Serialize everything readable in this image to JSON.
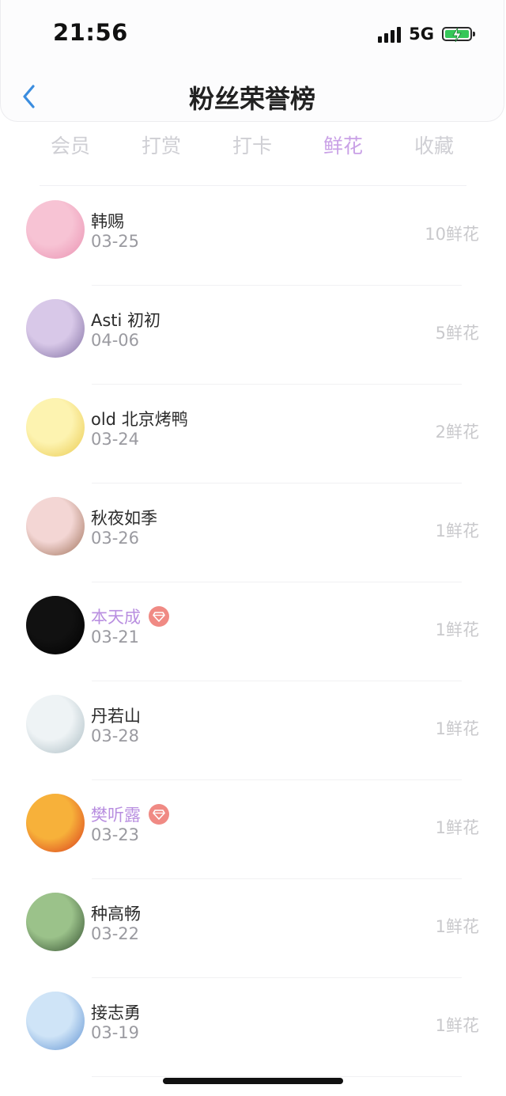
{
  "status_bar": {
    "time": "21:56",
    "network": "5G",
    "battery_level": 1.0,
    "battery_color": "#35c759"
  },
  "nav": {
    "title": "粉丝荣誉榜",
    "back_icon": "chevron-left-icon"
  },
  "tabs": [
    {
      "label": "会员",
      "active": false
    },
    {
      "label": "打赏",
      "active": false
    },
    {
      "label": "打卡",
      "active": false
    },
    {
      "label": "鲜花",
      "active": true
    },
    {
      "label": "收藏",
      "active": false
    }
  ],
  "colors": {
    "accent": "#c9a1e6",
    "vip_name": "#b98fe0",
    "vip_badge": "#f08a84",
    "back_icon": "#3b8ddf"
  },
  "fans": [
    {
      "name": "韩赐",
      "date": "03-25",
      "count": "10鲜花",
      "vip": false,
      "avatar_colors": [
        "#f7c3d4",
        "#e98fb0"
      ]
    },
    {
      "name": "Asti 初初",
      "date": "04-06",
      "count": "5鲜花",
      "vip": false,
      "avatar_colors": [
        "#d8c8e8",
        "#7c6a9e"
      ]
    },
    {
      "name": "old 北京烤鸭",
      "date": "03-24",
      "count": "2鲜花",
      "vip": false,
      "avatar_colors": [
        "#fdf3b0",
        "#e9c84a"
      ]
    },
    {
      "name": "秋夜如季",
      "date": "03-26",
      "count": "1鲜花",
      "vip": false,
      "avatar_colors": [
        "#f3d6d4",
        "#9b6b52"
      ]
    },
    {
      "name": "本天成",
      "date": "03-21",
      "count": "1鲜花",
      "vip": true,
      "avatar_colors": [
        "#111111",
        "#000000"
      ]
    },
    {
      "name": "丹若山",
      "date": "03-28",
      "count": "1鲜花",
      "vip": false,
      "avatar_colors": [
        "#eef3f5",
        "#a7b9c0"
      ]
    },
    {
      "name": "樊听露",
      "date": "03-23",
      "count": "1鲜花",
      "vip": true,
      "avatar_colors": [
        "#f7b13a",
        "#d8361b"
      ]
    },
    {
      "name": "种高畅",
      "date": "03-22",
      "count": "1鲜花",
      "vip": false,
      "avatar_colors": [
        "#9bc28a",
        "#2f4a2c"
      ]
    },
    {
      "name": "接志勇",
      "date": "03-19",
      "count": "1鲜花",
      "vip": false,
      "avatar_colors": [
        "#cfe4f7",
        "#5b8fd1"
      ]
    }
  ]
}
